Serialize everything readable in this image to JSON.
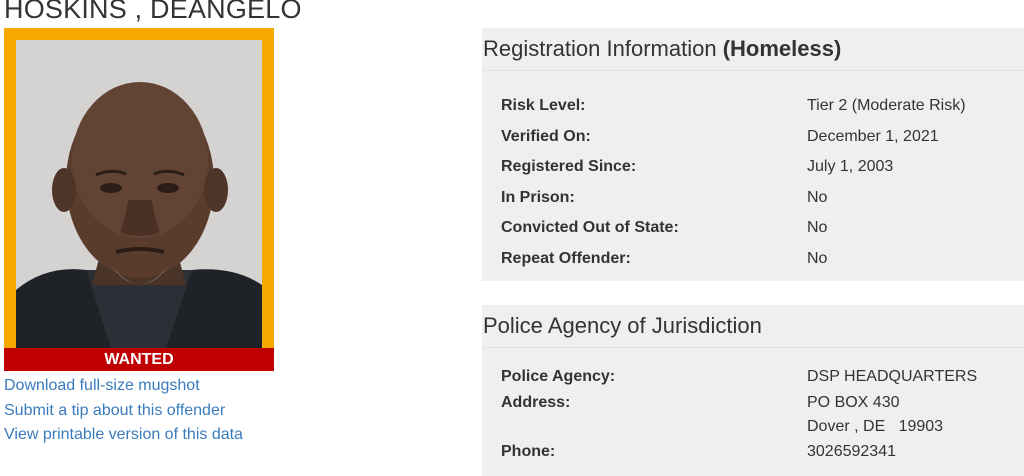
{
  "offender": {
    "name": "HOSKINS , DEANGELO",
    "badge": "WANTED"
  },
  "links": [
    {
      "label": "Download full-size mugshot"
    },
    {
      "label": "Submit a tip about this offender"
    },
    {
      "label": "View printable version of this data"
    }
  ],
  "registration": {
    "title": "Registration Information",
    "status": "(Homeless)",
    "rows": [
      {
        "label": "Risk Level:",
        "value": "Tier 2 (Moderate Risk)"
      },
      {
        "label": "Verified On:",
        "value": "December 1, 2021"
      },
      {
        "label": "Registered Since:",
        "value": "July 1, 2003"
      },
      {
        "label": "In Prison:",
        "value": "No"
      },
      {
        "label": "Convicted Out of State:",
        "value": "No"
      },
      {
        "label": "Repeat Offender:",
        "value": "No"
      }
    ]
  },
  "police": {
    "title": "Police Agency of Jurisdiction",
    "agency_label": "Police Agency:",
    "agency_value": "DSP HEADQUARTERS",
    "address_label": "Address:",
    "address_line1": "PO BOX 430",
    "address_line2": "Dover , DE   19903",
    "phone_label": "Phone:",
    "phone_value": "3026592341"
  },
  "colors": {
    "frame": "#f5a800",
    "badge": "#c00000",
    "link": "#3a7bbd",
    "panel": "#efefef"
  }
}
